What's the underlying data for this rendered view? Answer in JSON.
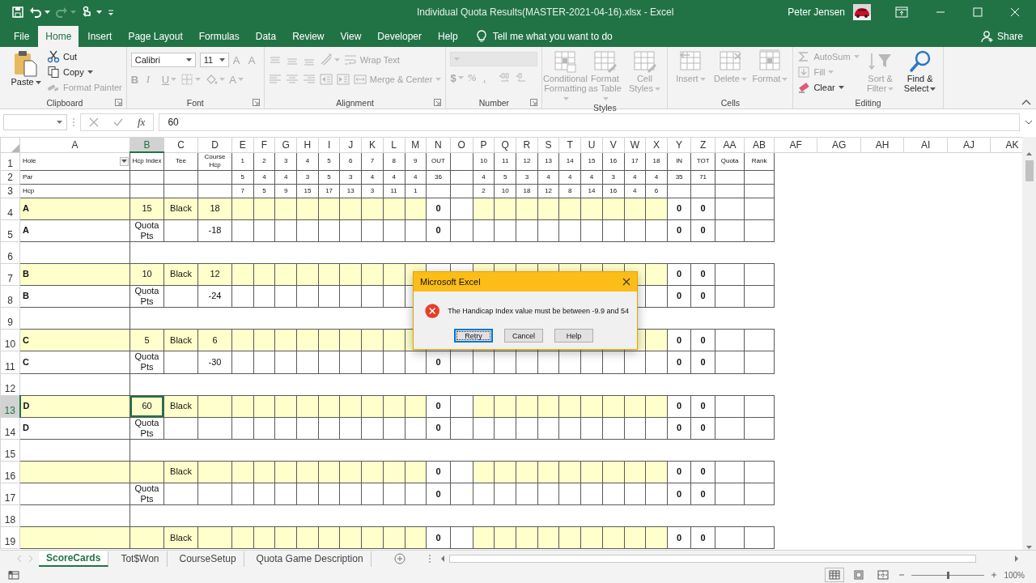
{
  "title_bar": {
    "quick_access": [
      {
        "dropdown": false,
        "disabled": false
      },
      {
        "dropdown": true,
        "disabled": false
      },
      {
        "dropdown": true,
        "disabled": true
      },
      {
        "dropdown": true,
        "disabled": false
      }
    ],
    "title": "Individual Quota Results(MASTER-2021-04-16).xlsx  -  Excel",
    "user": "Peter Jensen"
  },
  "tabs": [
    {
      "label": "File",
      "selected": false
    },
    {
      "label": "Home",
      "selected": true
    },
    {
      "label": "Insert",
      "selected": false
    },
    {
      "label": "Page Layout",
      "selected": false
    },
    {
      "label": "Formulas",
      "selected": false
    },
    {
      "label": "Data",
      "selected": false
    },
    {
      "label": "Review",
      "selected": false
    },
    {
      "label": "View",
      "selected": false
    },
    {
      "label": "Developer",
      "selected": false
    },
    {
      "label": "Help",
      "selected": false
    }
  ],
  "tell_me": {
    "placeholder": "Tell me what you want to do"
  },
  "share": "Share",
  "ribbon": {
    "groups": [
      {
        "label": "Clipboard",
        "launcher": true,
        "kind": "columns",
        "items": [
          [
            {
              "kind": "large",
              "label": "Paste",
              "dropdown": true,
              "disabled": false
            }
          ],
          [
            {
              "kind": "small",
              "label": "Cut",
              "dropdown": false,
              "disabled": false
            },
            {
              "kind": "small",
              "label": "Copy",
              "dropdown": true,
              "disabled": false
            },
            {
              "kind": "small",
              "label": "Format Painter",
              "dropdown": false,
              "disabled": true
            }
          ]
        ]
      },
      {
        "label": "Font",
        "launcher": true,
        "kind": "rows",
        "items": [
          [
            {
              "kind": "combo",
              "value": "Calibri",
              "disabled": false
            },
            {
              "kind": "combo",
              "value": "11",
              "disabled": false
            },
            {
              "kind": "glyph",
              "text": "A",
              "dropdown": false,
              "disabled": true
            },
            {
              "kind": "glyph",
              "text": "A",
              "dropdown": false,
              "disabled": true
            }
          ],
          [
            {
              "kind": "glyph",
              "text": "B",
              "dropdown": false,
              "disabled": true
            },
            {
              "kind": "glyph",
              "text": "I",
              "dropdown": false,
              "disabled": true
            },
            {
              "kind": "glyph",
              "text": "U",
              "dropdown": true,
              "disabled": true
            },
            {
              "kind": "tool",
              "dropdown": true,
              "disabled": true
            },
            {
              "kind": "tool",
              "dropdown": true,
              "disabled": true
            },
            {
              "kind": "glyph",
              "text": "A",
              "dropdown": true,
              "disabled": true
            }
          ]
        ]
      },
      {
        "label": "Alignment",
        "launcher": true,
        "kind": "rows",
        "items": [
          [
            {
              "kind": "tool",
              "dropdown": false,
              "disabled": true
            },
            {
              "kind": "tool",
              "dropdown": false,
              "disabled": true
            },
            {
              "kind": "tool",
              "dropdown": false,
              "disabled": true
            },
            {
              "kind": "tool",
              "dropdown": true,
              "disabled": true
            },
            {
              "kind": "small",
              "label": "Wrap Text",
              "dropdown": false,
              "disabled": true
            }
          ],
          [
            {
              "kind": "tool",
              "dropdown": false,
              "disabled": true
            },
            {
              "kind": "tool",
              "dropdown": false,
              "disabled": true
            },
            {
              "kind": "tool",
              "dropdown": false,
              "disabled": true
            },
            {
              "kind": "tool",
              "dropdown": false,
              "disabled": true
            },
            {
              "kind": "tool",
              "dropdown": false,
              "disabled": true
            },
            {
              "kind": "small",
              "label": "Merge & Center",
              "dropdown": true,
              "disabled": true
            }
          ]
        ]
      },
      {
        "label": "Number",
        "launcher": true,
        "kind": "rows",
        "items": [
          [
            {
              "kind": "combo",
              "disabled": true
            }
          ],
          [
            {
              "kind": "glyph",
              "text": "$",
              "dropdown": true,
              "disabled": true
            },
            {
              "kind": "glyph",
              "text": "%",
              "dropdown": false,
              "disabled": true
            },
            {
              "kind": "glyph",
              "text": ",",
              "dropdown": false,
              "disabled": true
            },
            {
              "kind": "tool",
              "dropdown": false,
              "disabled": true
            },
            {
              "kind": "tool",
              "dropdown": false,
              "disabled": true
            }
          ]
        ]
      },
      {
        "label": "Styles",
        "launcher": false,
        "kind": "columns",
        "items": [
          [
            {
              "kind": "large",
              "label": "Conditional Formatting",
              "dropdown": true,
              "disabled": true
            }
          ],
          [
            {
              "kind": "large",
              "label": "Format as Table",
              "dropdown": true,
              "disabled": true
            }
          ],
          [
            {
              "kind": "large",
              "label": "Cell Styles",
              "dropdown": true,
              "disabled": true
            }
          ]
        ]
      },
      {
        "label": "Cells",
        "launcher": false,
        "kind": "columns",
        "items": [
          [
            {
              "kind": "large",
              "label": "Insert",
              "dropdown": true,
              "disabled": true
            }
          ],
          [
            {
              "kind": "large",
              "label": "Delete",
              "dropdown": true,
              "disabled": true
            }
          ],
          [
            {
              "kind": "large",
              "label": "Format",
              "dropdown": true,
              "disabled": true
            }
          ]
        ]
      },
      {
        "label": "Editing",
        "launcher": false,
        "kind": "columns",
        "items": [
          [
            {
              "kind": "small",
              "label": "AutoSum",
              "dropdown": true,
              "disabled": true
            },
            {
              "kind": "small",
              "label": "Fill",
              "dropdown": true,
              "disabled": true
            },
            {
              "kind": "small",
              "label": "Clear",
              "dropdown": true,
              "disabled": false
            }
          ],
          [
            {
              "kind": "large",
              "label": "Sort & Filter",
              "dropdown": true,
              "disabled": true
            }
          ],
          [
            {
              "kind": "large",
              "label": "Find & Select",
              "dropdown": true,
              "disabled": false
            }
          ]
        ]
      }
    ]
  },
  "formula_bar": {
    "function_label": "fx",
    "value": "60"
  },
  "sheet": {
    "columns": [
      {
        "label": "A",
        "kind": "name",
        "selected": false
      },
      {
        "label": "B",
        "kind": "info",
        "selected": true
      },
      {
        "label": "C",
        "kind": "info",
        "selected": false
      },
      {
        "label": "D",
        "kind": "info",
        "selected": false
      },
      {
        "label": "E",
        "kind": "score",
        "selected": false
      },
      {
        "label": "F",
        "kind": "score",
        "selected": false
      },
      {
        "label": "G",
        "kind": "score",
        "selected": false
      },
      {
        "label": "H",
        "kind": "score",
        "selected": false
      },
      {
        "label": "I",
        "kind": "score",
        "selected": false
      },
      {
        "label": "J",
        "kind": "score",
        "selected": false
      },
      {
        "label": "K",
        "kind": "score",
        "selected": false
      },
      {
        "label": "L",
        "kind": "score",
        "selected": false
      },
      {
        "label": "M",
        "kind": "score",
        "selected": false
      },
      {
        "label": "N",
        "kind": "total",
        "selected": false
      },
      {
        "label": "O",
        "kind": "gap",
        "selected": false
      },
      {
        "label": "P",
        "kind": "score",
        "selected": false
      },
      {
        "label": "Q",
        "kind": "score",
        "selected": false
      },
      {
        "label": "R",
        "kind": "score",
        "selected": false
      },
      {
        "label": "S",
        "kind": "score",
        "selected": false
      },
      {
        "label": "T",
        "kind": "score",
        "selected": false
      },
      {
        "label": "U",
        "kind": "score",
        "selected": false
      },
      {
        "label": "V",
        "kind": "score",
        "selected": false
      },
      {
        "label": "W",
        "kind": "score",
        "selected": false
      },
      {
        "label": "X",
        "kind": "score",
        "selected": false
      },
      {
        "label": "Y",
        "kind": "total",
        "selected": false
      },
      {
        "label": "Z",
        "kind": "total",
        "selected": false
      },
      {
        "label": "AA",
        "kind": "extra",
        "selected": false
      },
      {
        "label": "AB",
        "kind": "extra",
        "selected": false
      },
      {
        "label": "AF",
        "kind": "blank",
        "selected": false
      },
      {
        "label": "AG",
        "kind": "blank",
        "selected": false
      },
      {
        "label": "AH",
        "kind": "blank",
        "selected": false
      },
      {
        "label": "AI",
        "kind": "blank",
        "selected": false
      },
      {
        "label": "AJ",
        "kind": "blank",
        "selected": false
      },
      {
        "label": "AK",
        "kind": "blank",
        "selected": false
      }
    ],
    "rows": [
      {
        "number": "1",
        "kind": "heading",
        "highlighted": false,
        "selected": false,
        "cells": [
          {
            "text": "Hole",
            "filter": true
          },
          {
            "text": "Hcp Index"
          },
          {
            "text": "Tee"
          },
          {
            "text": "Course Hcp"
          },
          {
            "text": "1"
          },
          {
            "text": "2"
          },
          {
            "text": "3"
          },
          {
            "text": "4"
          },
          {
            "text": "5"
          },
          {
            "text": "6"
          },
          {
            "text": "7"
          },
          {
            "text": "8"
          },
          {
            "text": "9"
          },
          {
            "text": "OUT"
          },
          {},
          {
            "text": "10"
          },
          {
            "text": "11"
          },
          {
            "text": "12"
          },
          {
            "text": "13"
          },
          {
            "text": "14"
          },
          {
            "text": "15"
          },
          {
            "text": "16"
          },
          {
            "text": "17"
          },
          {
            "text": "18"
          },
          {
            "text": "IN"
          },
          {
            "text": "TOT"
          },
          {
            "text": "Quota"
          },
          {
            "text": "Rank"
          }
        ]
      },
      {
        "number": "2",
        "kind": "heading",
        "highlighted": false,
        "selected": false,
        "cells": [
          {
            "text": "Par"
          },
          {},
          {},
          {},
          {
            "text": "5"
          },
          {
            "text": "4"
          },
          {
            "text": "4"
          },
          {
            "text": "3"
          },
          {
            "text": "5"
          },
          {
            "text": "3"
          },
          {
            "text": "4"
          },
          {
            "text": "4"
          },
          {
            "text": "4"
          },
          {
            "text": "36"
          },
          {},
          {
            "text": "4"
          },
          {
            "text": "5"
          },
          {
            "text": "3"
          },
          {
            "text": "4"
          },
          {
            "text": "4"
          },
          {
            "text": "4"
          },
          {
            "text": "3"
          },
          {
            "text": "4"
          },
          {
            "text": "4"
          },
          {
            "text": "35"
          },
          {
            "text": "71"
          }
        ]
      },
      {
        "number": "3",
        "kind": "heading",
        "highlighted": false,
        "selected": false,
        "cells": [
          {
            "text": "Hcp"
          },
          {},
          {},
          {},
          {
            "text": "7"
          },
          {
            "text": "5"
          },
          {
            "text": "9"
          },
          {
            "text": "15"
          },
          {
            "text": "17"
          },
          {
            "text": "13"
          },
          {
            "text": "3"
          },
          {
            "text": "11"
          },
          {
            "text": "1"
          },
          {},
          {},
          {
            "text": "2"
          },
          {
            "text": "10"
          },
          {
            "text": "18"
          },
          {
            "text": "12"
          },
          {
            "text": "8"
          },
          {
            "text": "14"
          },
          {
            "text": "16"
          },
          {
            "text": "4"
          },
          {
            "text": "6"
          }
        ]
      },
      {
        "number": "4",
        "kind": "player",
        "highlighted": true,
        "selected": false,
        "cells": [
          {
            "text": "A"
          },
          {
            "text": "15"
          },
          {
            "text": "Black"
          },
          {
            "text": "18"
          },
          {},
          {},
          {},
          {},
          {},
          {},
          {},
          {},
          {},
          {
            "text": "0"
          },
          {},
          {},
          {},
          {},
          {},
          {},
          {},
          {},
          {},
          {},
          {
            "text": "0"
          },
          {
            "text": "0"
          }
        ]
      },
      {
        "number": "5",
        "kind": "player",
        "highlighted": false,
        "selected": false,
        "cells": [
          {
            "text": "A"
          },
          {
            "text": "Quota Pts"
          },
          {},
          {
            "text": "-18"
          },
          {},
          {},
          {},
          {},
          {},
          {},
          {},
          {},
          {},
          {
            "text": "0"
          },
          {},
          {},
          {},
          {},
          {},
          {},
          {},
          {},
          {},
          {},
          {
            "text": "0"
          },
          {
            "text": "0"
          }
        ]
      },
      {
        "number": "6",
        "kind": "spacer",
        "highlighted": false,
        "selected": false
      },
      {
        "number": "7",
        "kind": "player",
        "highlighted": true,
        "selected": false,
        "cells": [
          {
            "text": "B"
          },
          {
            "text": "10"
          },
          {
            "text": "Black"
          },
          {
            "text": "12"
          },
          {},
          {},
          {},
          {},
          {},
          {},
          {},
          {},
          {},
          {},
          {},
          {},
          {},
          {},
          {},
          {},
          {},
          {},
          {},
          {},
          {
            "text": "0"
          },
          {
            "text": "0"
          }
        ]
      },
      {
        "number": "8",
        "kind": "player",
        "highlighted": false,
        "selected": false,
        "cells": [
          {
            "text": "B"
          },
          {
            "text": "Quota Pts"
          },
          {},
          {
            "text": "-24"
          },
          {},
          {},
          {},
          {},
          {},
          {},
          {},
          {},
          {},
          {},
          {},
          {},
          {},
          {},
          {},
          {},
          {},
          {},
          {},
          {},
          {
            "text": "0"
          },
          {
            "text": "0"
          }
        ]
      },
      {
        "number": "9",
        "kind": "spacer",
        "highlighted": false,
        "selected": false
      },
      {
        "number": "10",
        "kind": "player",
        "highlighted": true,
        "selected": false,
        "cells": [
          {
            "text": "C"
          },
          {
            "text": "5"
          },
          {
            "text": "Black"
          },
          {
            "text": "6"
          },
          {},
          {},
          {},
          {},
          {},
          {},
          {},
          {},
          {},
          {},
          {},
          {},
          {},
          {},
          {},
          {},
          {},
          {},
          {},
          {},
          {
            "text": "0"
          },
          {
            "text": "0"
          }
        ]
      },
      {
        "number": "11",
        "kind": "player",
        "highlighted": false,
        "selected": false,
        "cells": [
          {
            "text": "C"
          },
          {
            "text": "Quota Pts"
          },
          {},
          {
            "text": "-30"
          },
          {},
          {},
          {},
          {},
          {},
          {},
          {},
          {},
          {},
          {
            "text": "0"
          },
          {},
          {},
          {},
          {},
          {},
          {},
          {},
          {},
          {},
          {},
          {
            "text": "0"
          },
          {
            "text": "0"
          }
        ]
      },
      {
        "number": "12",
        "kind": "spacer",
        "highlighted": false,
        "selected": false
      },
      {
        "number": "13",
        "kind": "player",
        "highlighted": true,
        "selected": true,
        "cells": [
          {
            "text": "D"
          },
          {
            "text": "60"
          },
          {
            "text": "Black"
          },
          {},
          {},
          {},
          {},
          {},
          {},
          {},
          {},
          {},
          {},
          {
            "text": "0"
          },
          {},
          {},
          {},
          {},
          {},
          {},
          {},
          {},
          {},
          {},
          {
            "text": "0"
          },
          {
            "text": "0"
          }
        ]
      },
      {
        "number": "14",
        "kind": "player",
        "highlighted": false,
        "selected": false,
        "cells": [
          {
            "text": "D"
          },
          {
            "text": "Quota Pts"
          },
          {},
          {},
          {},
          {},
          {},
          {},
          {},
          {},
          {},
          {},
          {},
          {
            "text": "0"
          },
          {},
          {},
          {},
          {},
          {},
          {},
          {},
          {},
          {},
          {},
          {
            "text": "0"
          },
          {
            "text": "0"
          }
        ]
      },
      {
        "number": "15",
        "kind": "spacer",
        "highlighted": false,
        "selected": false
      },
      {
        "number": "16",
        "kind": "player",
        "highlighted": true,
        "selected": false,
        "cells": [
          {},
          {},
          {
            "text": "Black"
          },
          {},
          {},
          {},
          {},
          {},
          {},
          {},
          {},
          {},
          {},
          {
            "text": "0"
          },
          {},
          {},
          {},
          {},
          {},
          {},
          {},
          {},
          {},
          {},
          {
            "text": "0"
          },
          {
            "text": "0"
          }
        ]
      },
      {
        "number": "17",
        "kind": "player",
        "highlighted": false,
        "selected": false,
        "cells": [
          {},
          {
            "text": "Quota Pts"
          },
          {},
          {},
          {},
          {},
          {},
          {},
          {},
          {},
          {},
          {},
          {},
          {
            "text": "0"
          },
          {},
          {},
          {},
          {},
          {},
          {},
          {},
          {},
          {},
          {},
          {
            "text": "0"
          },
          {
            "text": "0"
          }
        ]
      },
      {
        "number": "18",
        "kind": "spacer",
        "highlighted": false,
        "selected": false
      },
      {
        "number": "19",
        "kind": "player",
        "highlighted": true,
        "selected": false,
        "cells": [
          {},
          {},
          {
            "text": "Black"
          },
          {},
          {},
          {},
          {},
          {},
          {},
          {},
          {},
          {},
          {},
          {
            "text": "0"
          },
          {},
          {},
          {},
          {},
          {},
          {},
          {},
          {},
          {},
          {},
          {
            "text": "0"
          },
          {
            "text": "0"
          }
        ]
      }
    ]
  },
  "dialog": {
    "title": "Microsoft Excel",
    "message": "The Handicap Index value must be between -9.9 and 54",
    "buttons": [
      {
        "label": "Retry",
        "selected": true
      },
      {
        "label": "Cancel",
        "selected": false
      },
      {
        "label": "Help",
        "selected": false
      }
    ]
  },
  "sheet_tabs": [
    {
      "label": "ScoreCards",
      "selected": true
    },
    {
      "label": "Tot$Won",
      "selected": false
    },
    {
      "label": "CourseSetup",
      "selected": false
    },
    {
      "label": "Quota Game Description",
      "selected": false
    }
  ],
  "status_bar": {
    "views": [
      {
        "selected": true
      },
      {
        "selected": false
      },
      {
        "selected": false
      }
    ],
    "zoom_slider": {
      "level": 0.5
    },
    "zoom": "100%"
  }
}
